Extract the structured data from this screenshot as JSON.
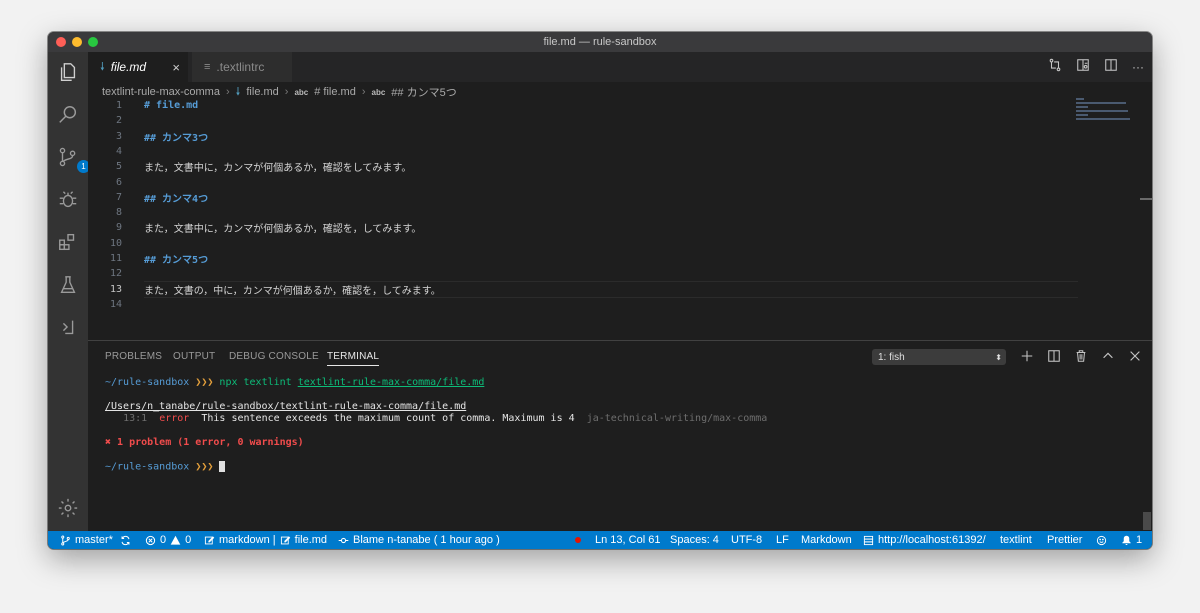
{
  "window": {
    "title": "file.md — rule-sandbox"
  },
  "colors": {
    "accent": "#007acc",
    "heading": "#569cd6",
    "error": "#f14c4c",
    "prompt": "#569cd6",
    "command_green": "#0dbc79"
  },
  "activity_bar": {
    "items": [
      "explorer-icon",
      "search-icon",
      "source-control-icon",
      "debug-icon",
      "extensions-icon",
      "test-flask-icon",
      "remote-icon"
    ],
    "source_control_badge": "1",
    "bottom": "gear-icon"
  },
  "tabs": [
    {
      "label": "file.md",
      "icon": "🠗",
      "active": true,
      "close": "×"
    },
    {
      "label": ".textlintrc",
      "icon": "≡",
      "active": false
    }
  ],
  "breadcrumb": {
    "items": [
      "textlint-rule-max-comma",
      "file.md",
      "# file.md",
      "## カンマ5つ"
    ],
    "abc": "abc",
    "sep": "›"
  },
  "editor": {
    "current_line": 13,
    "lines": [
      {
        "n": "1",
        "text": "# file.md",
        "heading": true
      },
      {
        "n": "2",
        "text": "",
        "heading": false
      },
      {
        "n": "3",
        "text": "## カンマ3つ",
        "heading": true
      },
      {
        "n": "4",
        "text": "",
        "heading": false
      },
      {
        "n": "5",
        "text": "また，文書中に，カンマが何個あるか，確認をしてみます。",
        "heading": false
      },
      {
        "n": "6",
        "text": "",
        "heading": false
      },
      {
        "n": "7",
        "text": "## カンマ4つ",
        "heading": true
      },
      {
        "n": "8",
        "text": "",
        "heading": false
      },
      {
        "n": "9",
        "text": "また，文書中に，カンマが何個あるか，確認を，してみます。",
        "heading": false
      },
      {
        "n": "10",
        "text": "",
        "heading": false
      },
      {
        "n": "11",
        "text": "## カンマ5つ",
        "heading": true
      },
      {
        "n": "12",
        "text": "",
        "heading": false
      },
      {
        "n": "13",
        "text": "また，文書の，中に，カンマが何個あるか，確認を，してみます。",
        "heading": false
      },
      {
        "n": "14",
        "text": "",
        "heading": false
      }
    ]
  },
  "panel": {
    "tabs": [
      "PROBLEMS",
      "OUTPUT",
      "DEBUG CONSOLE",
      "TERMINAL"
    ],
    "active_tab": "TERMINAL",
    "terminal_select": "1: fish",
    "terminal": {
      "prompt": "~/rule-sandbox",
      "chevrons": "❯❯❯",
      "cmd": "npx textlint",
      "cmd_arg": "textlint-rule-max-comma/file.md",
      "file_path": "/Users/n_tanabe/rule-sandbox/textlint-rule-max-comma/file.md",
      "error_pos": "13:1",
      "error_label": "error",
      "error_msg": "This sentence exceeds the maximum count of comma. Maximum is 4",
      "error_rule": "ja-technical-writing/max-comma",
      "summary": "✖ 1 problem (1 error, 0 warnings)"
    }
  },
  "statusbar": {
    "branch": "master*",
    "errors": "0",
    "warnings": "0",
    "lang_breadcrumb": "markdown | ",
    "file": "file.md",
    "blame": "Blame n-tanabe ( 1 hour ago )",
    "position": "Ln 13, Col 61",
    "spaces": "Spaces: 4",
    "encoding": "UTF-8",
    "eol": "LF",
    "language": "Markdown",
    "url": "http://localhost:61392/",
    "linter": "textlint",
    "formatter": "Prettier",
    "notifications": "1"
  }
}
